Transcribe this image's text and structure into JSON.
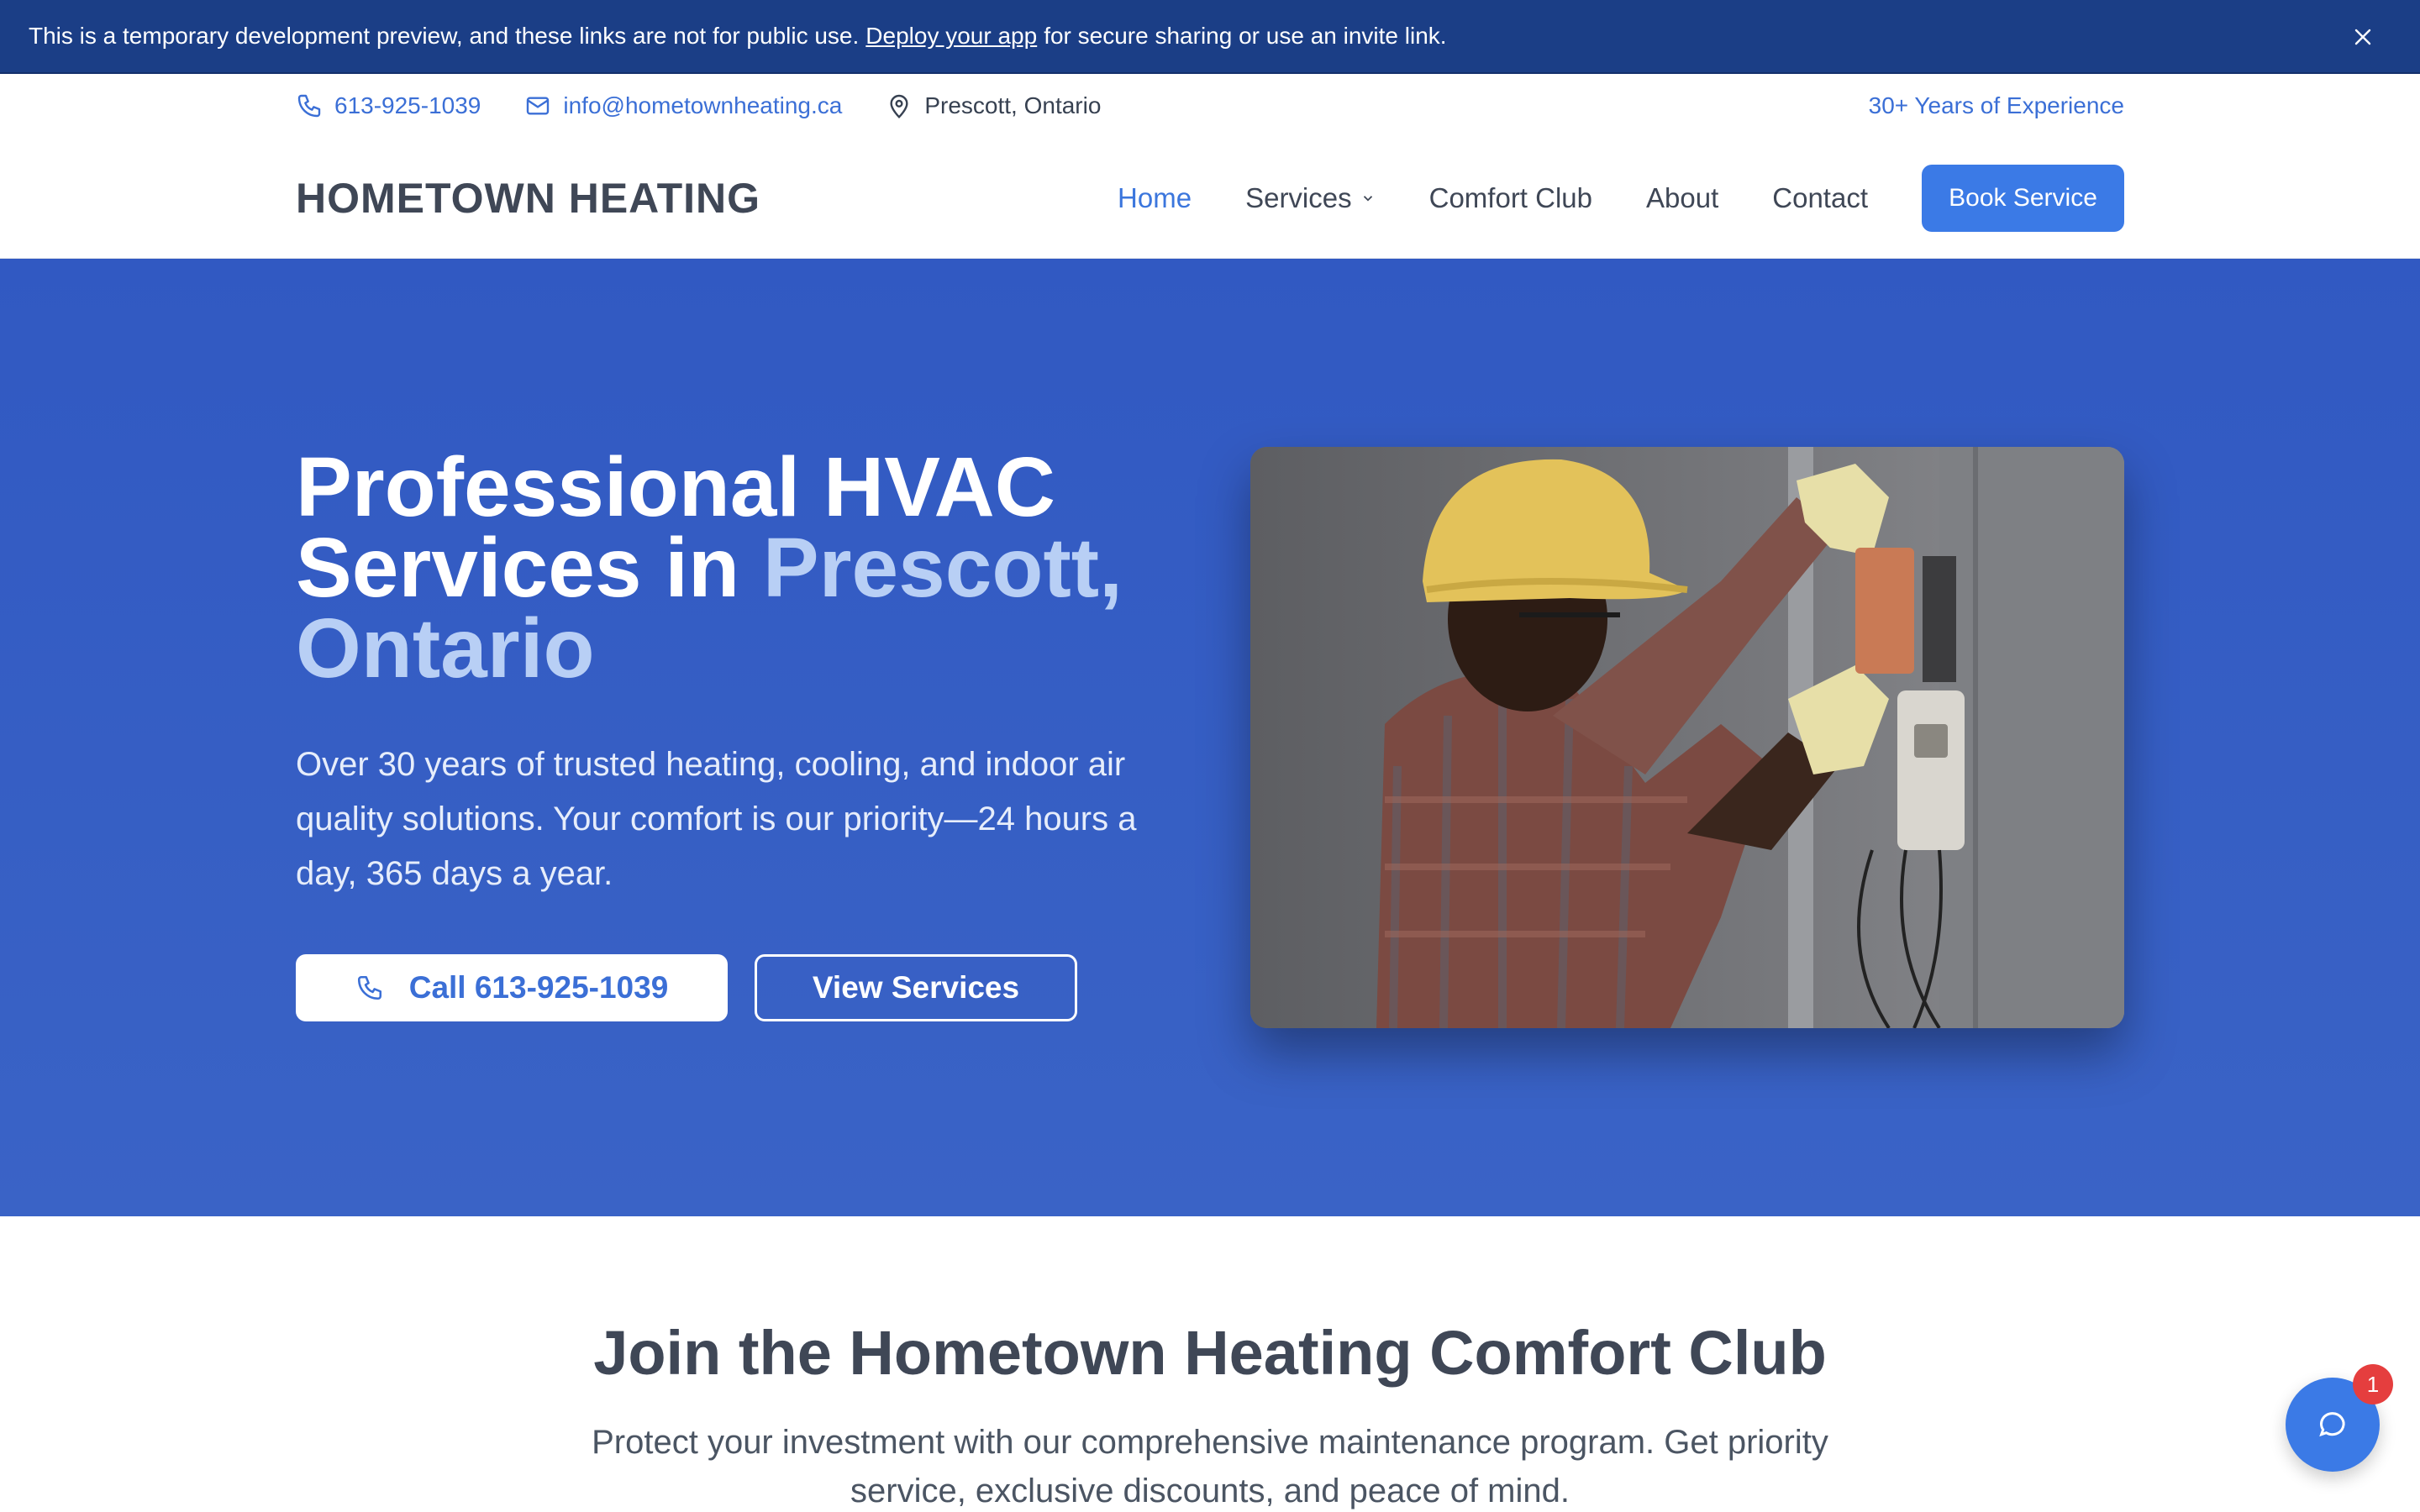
{
  "banner": {
    "text_before": "This is a temporary development preview, and these links are not for public use.",
    "link": "Deploy your app",
    "text_after": "for secure sharing or use an invite link."
  },
  "topbar": {
    "phone": "613-925-1039",
    "email": "info@hometownheating.ca",
    "location": "Prescott, Ontario",
    "experience": "30+ Years of Experience"
  },
  "nav": {
    "logo": "HOMETOWN HEATING",
    "links": [
      "Home",
      "Services",
      "Comfort Club",
      "About",
      "Contact"
    ],
    "active": "Home",
    "cta": "Book Service"
  },
  "hero": {
    "title_line1": "Professional HVAC",
    "title_line2": "Services in ",
    "title_accent": "Prescott, Ontario",
    "lead": "Over 30 years of trusted heating, cooling, and indoor air quality solutions. Your comfort is our priority—24 hours a day, 365 days a year.",
    "call_button": "Call 613-925-1039",
    "services_button": "View Services"
  },
  "club": {
    "title": "Join the Hometown Heating Comfort Club",
    "text": "Protect your investment with our comprehensive maintenance program. Get priority service, exclusive discounts, and peace of mind."
  },
  "chat": {
    "badge": "1"
  },
  "colors": {
    "primary": "#3b7ae6",
    "hero_bg": "#3159c2",
    "banner_bg": "#1b3e86",
    "accent_text": "#b8cff5"
  }
}
